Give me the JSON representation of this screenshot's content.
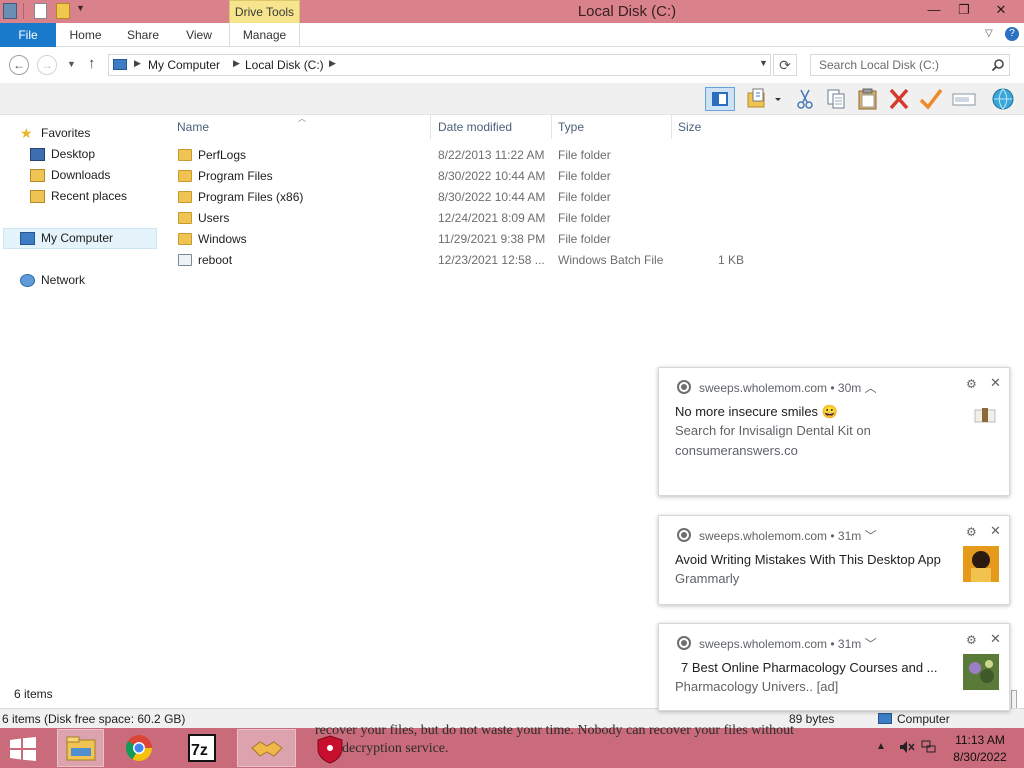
{
  "window": {
    "title": "Local Disk (C:)",
    "contextual_tab": "Drive Tools",
    "controls": {
      "minimize": "—",
      "maximize": "❐",
      "close": "✕"
    }
  },
  "ribbon": {
    "tabs": [
      "File",
      "Home",
      "Share",
      "View",
      "Manage"
    ],
    "help": "?"
  },
  "address": {
    "breadcrumb": [
      "My Computer",
      "Local Disk (C:)"
    ],
    "search_placeholder": "Search Local Disk (C:)"
  },
  "nav_pane": {
    "favorites": "Favorites",
    "items": [
      "Desktop",
      "Downloads",
      "Recent places"
    ],
    "my_computer": "My Computer",
    "network": "Network"
  },
  "file_list": {
    "columns": [
      "Name",
      "Date modified",
      "Type",
      "Size"
    ],
    "rows": [
      {
        "name": "PerfLogs",
        "date": "8/22/2013 11:22 AM",
        "type": "File folder",
        "size": ""
      },
      {
        "name": "Program Files",
        "date": "8/30/2022 10:44 AM",
        "type": "File folder",
        "size": ""
      },
      {
        "name": "Program Files (x86)",
        "date": "8/30/2022 10:44 AM",
        "type": "File folder",
        "size": ""
      },
      {
        "name": "Users",
        "date": "12/24/2021 8:09 AM",
        "type": "File folder",
        "size": ""
      },
      {
        "name": "Windows",
        "date": "11/29/2021 9:38 PM",
        "type": "File folder",
        "size": ""
      },
      {
        "name": "reboot",
        "date": "12/23/2021 12:58 ...",
        "type": "Windows Batch File",
        "size": "1 KB"
      }
    ]
  },
  "status": {
    "item_count": "6 items",
    "disk_free": "6 items (Disk free space: 60.2 GB)",
    "bytes": "89 bytes",
    "location": "Computer"
  },
  "notifications": [
    {
      "source": "sweeps.wholemom.com",
      "time": "30m",
      "title": "No more insecure smiles 😀",
      "body": [
        "Search for Invisalign Dental Kit on",
        "consumeranswers.co"
      ]
    },
    {
      "source": "sweeps.wholemom.com",
      "time": "31m",
      "title": "Avoid Writing Mistakes With This Desktop App",
      "body": [
        "Grammarly"
      ]
    },
    {
      "source": "sweeps.wholemom.com",
      "time": "31m",
      "title": "7 Best Online Pharmacology Courses and ...",
      "body": [
        "Pharmacology Univers.. [ad]"
      ]
    }
  ],
  "background_text": [
    "recover your files, but do not waste your time. Nobody can recover your files without",
    "decryption service."
  ],
  "taskbar": {
    "apps": [
      "File Explorer",
      "Google Chrome",
      "7-Zip",
      "Handshake",
      "Shield"
    ],
    "time": "11:13 AM",
    "date": "8/30/2022"
  },
  "colors": {
    "titlebar": "#d9828c",
    "file_tab": "#1979ca",
    "drive_tools": "#f6e58d",
    "taskbar": "#c96b7a"
  }
}
